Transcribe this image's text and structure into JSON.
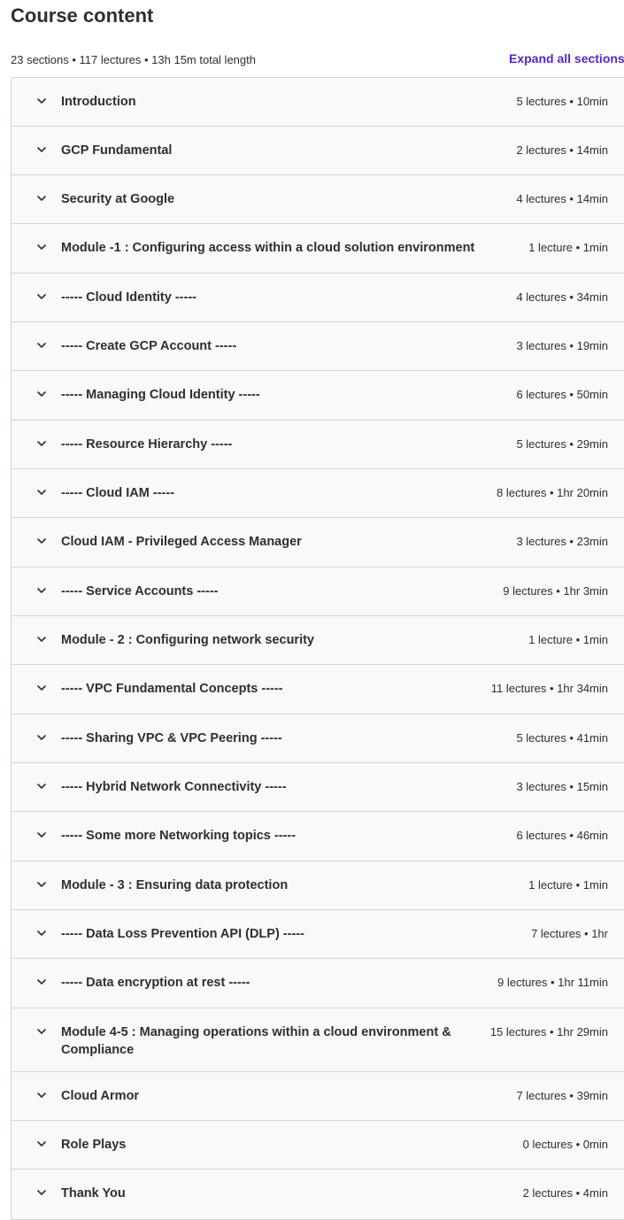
{
  "heading": "Course content",
  "summary": "23 sections • 117 lectures • 13h 15m total length",
  "expand_all": "Expand all sections",
  "sections": [
    {
      "title": "Introduction",
      "meta": "5 lectures • 10min"
    },
    {
      "title": "GCP Fundamental",
      "meta": "2 lectures • 14min"
    },
    {
      "title": "Security at Google",
      "meta": "4 lectures • 14min"
    },
    {
      "title": "Module -1 : Configuring access within a cloud solution environment",
      "meta": "1 lecture • 1min"
    },
    {
      "title": "----- Cloud Identity -----",
      "meta": "4 lectures • 34min"
    },
    {
      "title": "----- Create GCP Account -----",
      "meta": "3 lectures • 19min"
    },
    {
      "title": "----- Managing Cloud Identity -----",
      "meta": "6 lectures • 50min"
    },
    {
      "title": "----- Resource Hierarchy -----",
      "meta": "5 lectures • 29min"
    },
    {
      "title": "----- Cloud IAM -----",
      "meta": "8 lectures • 1hr 20min"
    },
    {
      "title": "Cloud IAM - Privileged Access Manager",
      "meta": "3 lectures • 23min"
    },
    {
      "title": "----- Service Accounts -----",
      "meta": "9 lectures • 1hr 3min"
    },
    {
      "title": "Module - 2 : Configuring network security",
      "meta": "1 lecture • 1min"
    },
    {
      "title": "----- VPC Fundamental Concepts -----",
      "meta": "11 lectures • 1hr 34min"
    },
    {
      "title": "----- Sharing VPC & VPC Peering -----",
      "meta": "5 lectures • 41min"
    },
    {
      "title": "----- Hybrid Network Connectivity -----",
      "meta": "3 lectures • 15min"
    },
    {
      "title": "----- Some more Networking topics -----",
      "meta": "6 lectures • 46min"
    },
    {
      "title": "Module - 3 : Ensuring data protection",
      "meta": "1 lecture • 1min"
    },
    {
      "title": "----- Data Loss Prevention API (DLP) -----",
      "meta": "7 lectures • 1hr"
    },
    {
      "title": "----- Data encryption at rest -----",
      "meta": "9 lectures • 1hr 11min"
    },
    {
      "title": "Module 4-5 : Managing operations within a cloud environment & Compliance",
      "meta": "15 lectures • 1hr 29min"
    },
    {
      "title": "Cloud Armor",
      "meta": "7 lectures • 39min"
    },
    {
      "title": "Role Plays",
      "meta": "0 lectures • 0min"
    },
    {
      "title": "Thank You",
      "meta": "2 lectures • 4min"
    }
  ],
  "colors": {
    "accent": "#5624d0",
    "row_bg": "#f7f9fa",
    "border": "#d1d7dc",
    "text": "#2d2f31"
  },
  "icons": {
    "section_toggle": "chevron-down-icon"
  }
}
